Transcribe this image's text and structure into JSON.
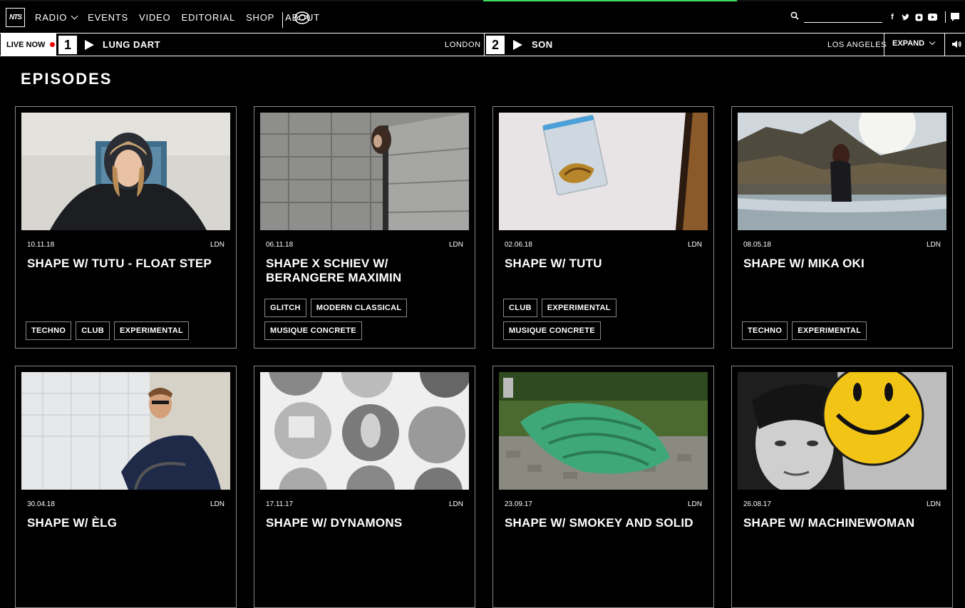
{
  "nav": {
    "logo": "NTS",
    "items": [
      "RADIO",
      "EVENTS",
      "VIDEO",
      "EDITORIAL",
      "SHOP",
      "ABOUT"
    ]
  },
  "search": {
    "placeholder": ""
  },
  "social_icons": [
    "facebook-icon",
    "twitter-icon",
    "instagram-icon",
    "youtube-icon"
  ],
  "live": {
    "label": "LIVE NOW",
    "channels": [
      {
        "number": "1",
        "title": "LUNG DART",
        "location": "LONDON"
      },
      {
        "number": "2",
        "title": "SON",
        "location": "LOS ANGELES"
      }
    ],
    "expand_label": "EXPAND"
  },
  "page": {
    "heading": "EPISODES"
  },
  "episodes": [
    {
      "date": "10.11.18",
      "loc": "LDN",
      "title": "SHAPE W/ TUTU - FLOAT STEP",
      "tags": [
        "TECHNO",
        "CLUB",
        "EXPERIMENTAL"
      ]
    },
    {
      "date": "06.11.18",
      "loc": "LDN",
      "title": "SHAPE X SCHIEV W/ BERANGERE MAXIMIN",
      "tags": [
        "GLITCH",
        "MODERN CLASSICAL",
        "MUSIQUE CONCRETE"
      ]
    },
    {
      "date": "02.06.18",
      "loc": "LDN",
      "title": "SHAPE W/ TUTU",
      "tags": [
        "CLUB",
        "EXPERIMENTAL",
        "MUSIQUE CONCRETE"
      ]
    },
    {
      "date": "08.05.18",
      "loc": "LDN",
      "title": "SHAPE W/ MIKA OKI",
      "tags": [
        "TECHNO",
        "EXPERIMENTAL"
      ]
    },
    {
      "date": "30.04.18",
      "loc": "LDN",
      "title": "SHAPE W/ ÈLG",
      "tags": []
    },
    {
      "date": "17.11.17",
      "loc": "LDN",
      "title": "SHAPE W/ DYNAMONS",
      "tags": []
    },
    {
      "date": "23.09.17",
      "loc": "LDN",
      "title": "SHAPE W/ SMOKEY AND SOLID",
      "tags": []
    },
    {
      "date": "26.08.17",
      "loc": "LDN",
      "title": "SHAPE W/ MACHINEWOMAN",
      "tags": []
    }
  ]
}
